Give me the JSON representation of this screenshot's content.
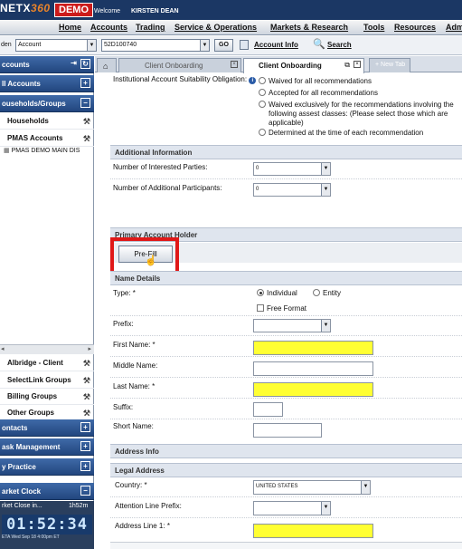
{
  "header": {
    "logo_prefix": "NETX",
    "logo_suffix": "360",
    "environment_badge": "DEMO",
    "welcome_label": "Welcome",
    "user_name": "KIRSTEN DEAN"
  },
  "menu": [
    {
      "label": "Home"
    },
    {
      "label": "Accounts"
    },
    {
      "label": "Trading"
    },
    {
      "label": "Service & Operations"
    },
    {
      "label": "Markets & Research"
    },
    {
      "label": "Tools"
    },
    {
      "label": "Resources"
    },
    {
      "label": "Adm"
    }
  ],
  "searchbar": {
    "left_label": "den",
    "type_value": "Account",
    "account_value": "52D100740",
    "go_label": "GO",
    "account_info_label": "Account Info",
    "search_label": "Search"
  },
  "sidebar": {
    "accounts_header": "ccounts",
    "all_accounts": "ll Accounts",
    "households_groups": "ouseholds/Groups",
    "households": "Households",
    "pmas_accounts": "PMAS Accounts",
    "pmas_demo": "PMAS DEMO MAIN DIS",
    "albridge": "Albridge - Client",
    "selectlink": "SelectLink Groups",
    "billing": "Billing Groups",
    "other": "Other Groups",
    "contacts": "ontacts",
    "task_management": "ask Management",
    "my_practice": "y Practice",
    "market_clock": "arket Clock",
    "market_close_in": "rket Close in...",
    "market_close_time": "1h52m",
    "clock_digits": "01:52:34",
    "clock_date": "ETA  Wed Sep 18 4:00pm ET"
  },
  "tabs": {
    "home_icon": "home-icon",
    "tab1": "Client Onboarding",
    "tab2": "Client Onboarding",
    "new_tab": "+ New Tab"
  },
  "form": {
    "inst_suitability_label": "Institutional Account Suitability Obligation:",
    "inst_options": [
      "Waived for all recommendations",
      "Accepted for all recommendations",
      "Waived exclusively for the recommendations involving the following assest classes: (Please select those which are applicable)",
      "Determined at the time of each recommendation"
    ],
    "additional_info_header": "Additional Information",
    "interested_parties_label": "Number of Interested Parties:",
    "interested_parties_value": "0",
    "additional_participants_label": "Number of Additional Participants:",
    "additional_participants_value": "0",
    "primary_holder_header": "Primary Account Holder",
    "prefill_label": "Pre-Fill",
    "name_details_header": "Name Details",
    "type_label": "Type: *",
    "type_individual": "Individual",
    "type_entity": "Entity",
    "free_format_label": "Free Format",
    "prefix_label": "Prefix:",
    "first_name_label": "First Name: *",
    "middle_name_label": "Middle Name:",
    "last_name_label": "Last Name: *",
    "suffix_label": "Suffix:",
    "short_name_label": "Short Name:",
    "address_info_header": "Address Info",
    "legal_address_header": "Legal Address",
    "country_label": "Country: *",
    "country_value": "UNITED STATES",
    "attention_prefix_label": "Attention Line Prefix:",
    "address_line1_label": "Address Line 1: *"
  },
  "colors": {
    "required_field": "#ffff33",
    "highlight_box": "#e01818",
    "header_navy": "#1b3764"
  }
}
